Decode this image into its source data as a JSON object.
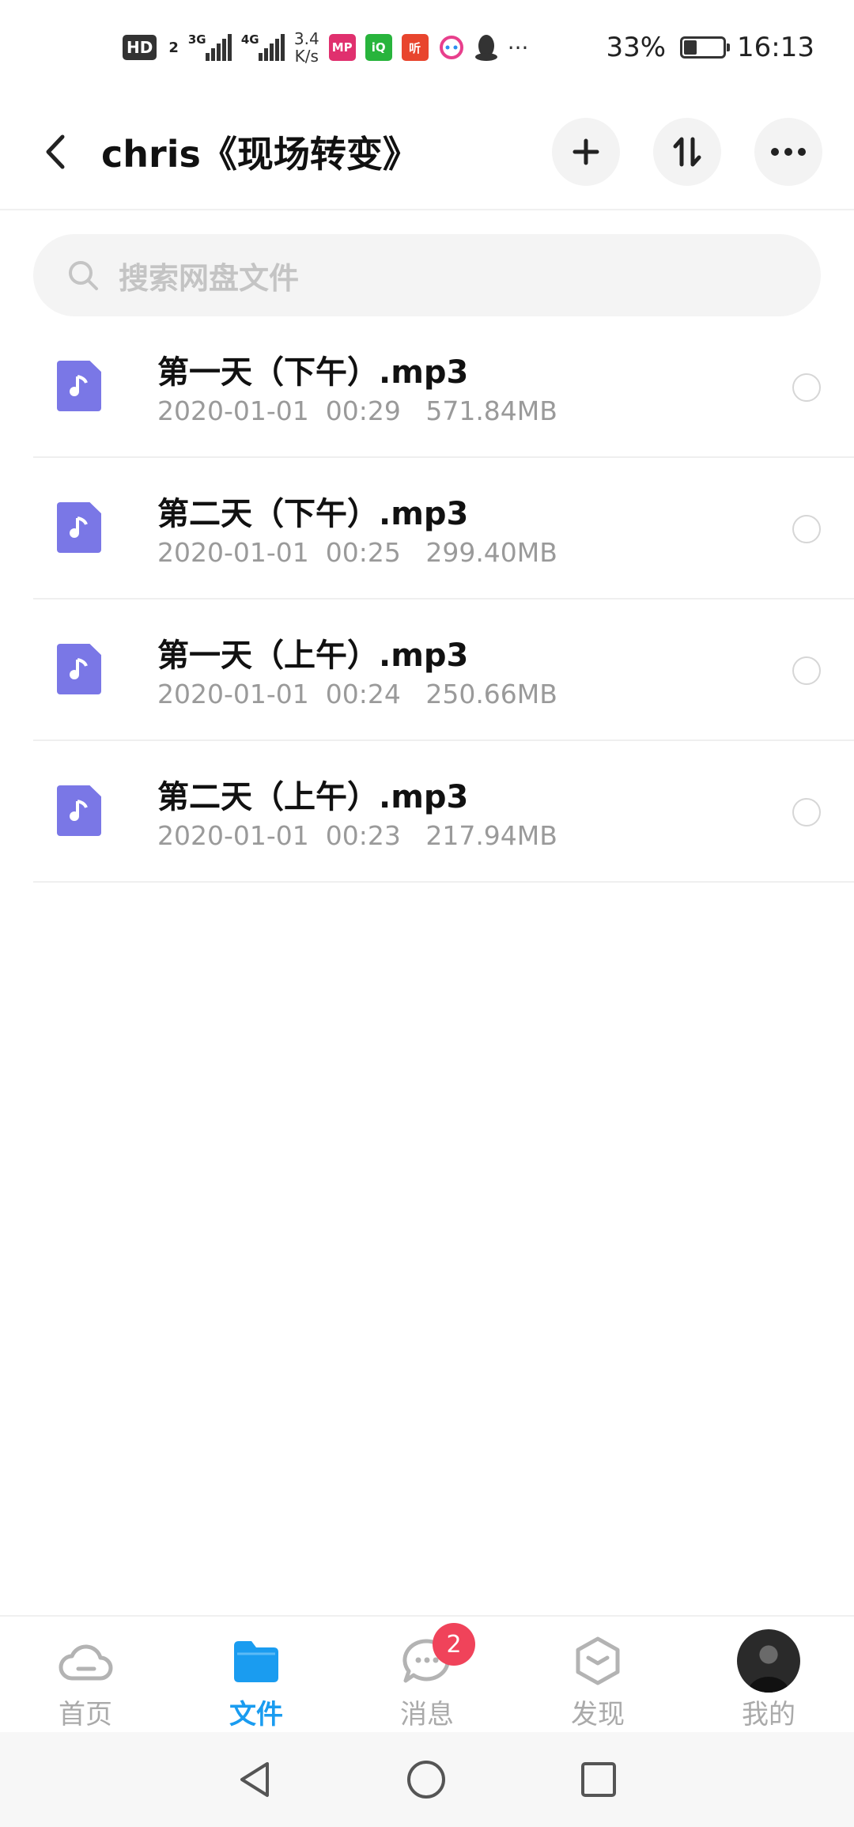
{
  "status_bar": {
    "hd_label": "HD",
    "hd_sub": "2",
    "sig1_label": "3G",
    "sig2_label": "4G",
    "speed_value": "3.4",
    "speed_unit": "K/s",
    "app_icons": [
      {
        "name": "mp-app-icon",
        "text": "MP",
        "color": "#e0306e"
      },
      {
        "name": "iqiyi-app-icon",
        "text": "iQ",
        "color": "#28b43c"
      },
      {
        "name": "ting-app-icon",
        "text": "听",
        "color": "#e8452e"
      }
    ],
    "more": "···",
    "battery_text": "33%",
    "battery_level": 0.33,
    "time": "16:13"
  },
  "header": {
    "title": "chris《现场转变》"
  },
  "search": {
    "placeholder": "搜索网盘文件"
  },
  "files": [
    {
      "name": "第一天（下午）.mp3",
      "meta": "2020-01-01  00:29   571.84MB"
    },
    {
      "name": "第二天（下午）.mp3",
      "meta": "2020-01-01  00:25   299.40MB"
    },
    {
      "name": "第一天（上午）.mp3",
      "meta": "2020-01-01  00:24   250.66MB"
    },
    {
      "name": "第二天（上午）.mp3",
      "meta": "2020-01-01  00:23   217.94MB"
    }
  ],
  "nav": {
    "items": [
      {
        "label": "首页"
      },
      {
        "label": "文件"
      },
      {
        "label": "消息",
        "badge": "2"
      },
      {
        "label": "发现"
      },
      {
        "label": "我的"
      }
    ],
    "active_color": "#1a9cf0"
  }
}
